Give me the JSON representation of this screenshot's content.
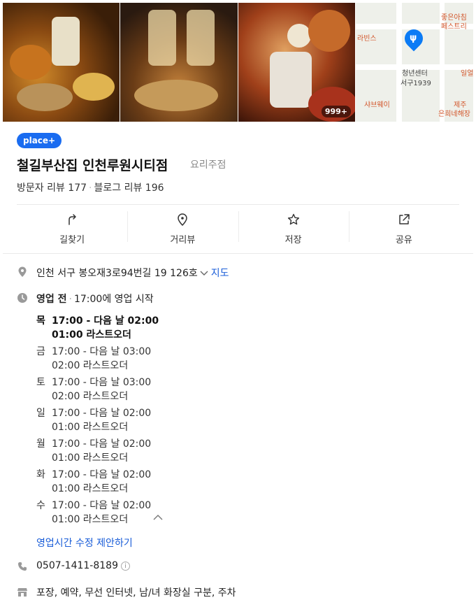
{
  "photos": {
    "more_count": "999+"
  },
  "map": {
    "labels": [
      {
        "text": "좋은아침",
        "kind": "poi"
      },
      {
        "text": "페스트리",
        "kind": "poi"
      },
      {
        "text": "라빈스",
        "kind": "poi"
      },
      {
        "text": "일얼",
        "kind": "poi"
      },
      {
        "text": "청년센터",
        "kind": "dark"
      },
      {
        "text": "서구1939",
        "kind": "dark"
      },
      {
        "text": "샤브웨이",
        "kind": "poi"
      },
      {
        "text": "제주",
        "kind": "poi"
      },
      {
        "text": "은희네해장",
        "kind": "poi"
      }
    ],
    "pin_color": "#0b7bf5"
  },
  "header": {
    "badge": "place+",
    "title": "철길부산집 인천루원시티점",
    "category": "요리주점",
    "visitor_reviews": "방문자 리뷰 177",
    "blog_reviews": "블로그 리뷰 196"
  },
  "actions": [
    {
      "label": "길찾기",
      "icon": "directions-icon"
    },
    {
      "label": "거리뷰",
      "icon": "street-view-icon"
    },
    {
      "label": "저장",
      "icon": "star-icon"
    },
    {
      "label": "공유",
      "icon": "share-icon"
    }
  ],
  "address": {
    "text": "인천 서구 봉오재3로94번길 19 126호",
    "map_link": "지도"
  },
  "hours": {
    "status": "영업 전",
    "next_open": "17:00에 영업 시작",
    "days": [
      {
        "day": "목",
        "time": "17:00 - 다음 날 02:00",
        "last_order": "01:00 라스트오더",
        "today": true
      },
      {
        "day": "금",
        "time": "17:00 - 다음 날 03:00",
        "last_order": "02:00 라스트오더",
        "today": false
      },
      {
        "day": "토",
        "time": "17:00 - 다음 날 03:00",
        "last_order": "02:00 라스트오더",
        "today": false
      },
      {
        "day": "일",
        "time": "17:00 - 다음 날 02:00",
        "last_order": "01:00 라스트오더",
        "today": false
      },
      {
        "day": "월",
        "time": "17:00 - 다음 날 02:00",
        "last_order": "01:00 라스트오더",
        "today": false
      },
      {
        "day": "화",
        "time": "17:00 - 다음 날 02:00",
        "last_order": "01:00 라스트오더",
        "today": false
      },
      {
        "day": "수",
        "time": "17:00 - 다음 날 02:00",
        "last_order": "01:00 라스트오더",
        "today": false
      }
    ],
    "suggest_link": "영업시간 수정 제안하기"
  },
  "phone": "0507-1411-8189",
  "facilities": "포장, 예약, 무선 인터넷, 남/녀 화장실 구분, 주차",
  "colors": {
    "link": "#1a5dd8",
    "badge": "#1a6cf0"
  }
}
